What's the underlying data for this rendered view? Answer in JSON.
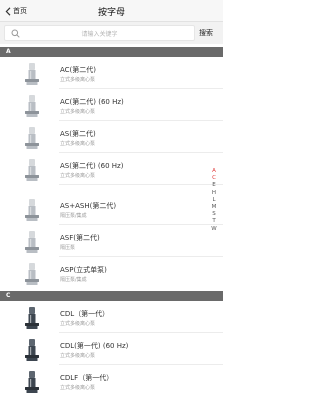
{
  "nav": {
    "back_label": "首页",
    "title": "按字母"
  },
  "search": {
    "placeholder": "请输入关键字",
    "button_label": "搜索"
  },
  "sections": [
    {
      "letter": "A",
      "items": [
        {
          "name": "AC(第二代)",
          "desc": "立式多级离心泵"
        },
        {
          "name": "AC(第二代) (60 Hz)",
          "desc": "立式多级离心泵"
        },
        {
          "name": "AS(第二代)",
          "desc": "立式多级离心泵"
        },
        {
          "name": "AS(第二代) (60 Hz)",
          "desc": "立式多级离心泵"
        },
        {
          "name": "AS+ASH(第二代)",
          "desc": "隔压泵/集成"
        },
        {
          "name": "ASF(第二代)",
          "desc": "隔压泵"
        },
        {
          "name": "ASP(立式单泵)",
          "desc": "隔压泵/集成"
        }
      ]
    },
    {
      "letter": "C",
      "items": [
        {
          "name": "CDL（第一代）",
          "desc": "立式多级离心泵"
        },
        {
          "name": "CDL(第一代) (60 Hz)",
          "desc": "立式多级离心泵"
        },
        {
          "name": "CDLF（第一代）",
          "desc": "立式多级离心泵"
        }
      ]
    }
  ],
  "index_letters": [
    "A",
    "C",
    "E",
    "H",
    "L",
    "M",
    "S",
    "T",
    "W"
  ],
  "colors": {
    "section_bg": "#6a6a6a",
    "index_active": "#e03a3a"
  },
  "icons": {
    "back": "chevron-left-icon",
    "search": "search-icon"
  }
}
